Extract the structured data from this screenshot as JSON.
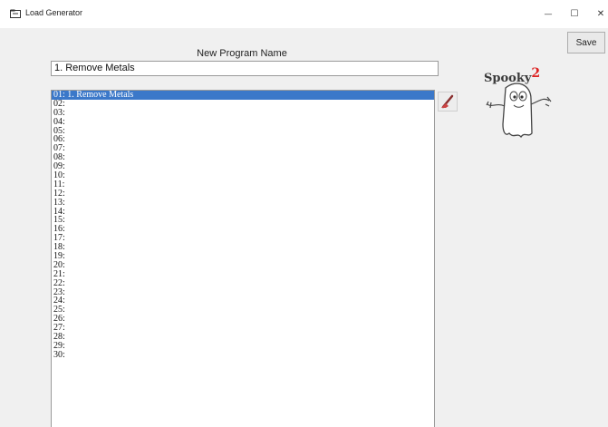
{
  "window": {
    "title": "Load Generator",
    "controls": {
      "minimize": "—",
      "maximize": "☐",
      "close": "✕"
    }
  },
  "form": {
    "program_name_label": "New Program Name",
    "program_name_value": "1. Remove Metals",
    "save_label": "Save"
  },
  "logo": {
    "text": "Spooky",
    "superscript": "2"
  },
  "program_list": {
    "selected_index": 0,
    "items": [
      "01: 1. Remove Metals",
      "02:",
      "03:",
      "04:",
      "05:",
      "06:",
      "07:",
      "08:",
      "09:",
      "10:",
      "11:",
      "12:",
      "13:",
      "14:",
      "15:",
      "16:",
      "17:",
      "18:",
      "19:",
      "20:",
      "21:",
      "22:",
      "23:",
      "24:",
      "25:",
      "26:",
      "27:",
      "28:",
      "29:",
      "30:"
    ]
  },
  "icons": {
    "app": "generator-app-icon",
    "erase": "eraser-icon",
    "ghost": "ghost-mascot-icon"
  },
  "colors": {
    "selection": "#3b78c9",
    "logo_superscript": "#dd2222"
  }
}
